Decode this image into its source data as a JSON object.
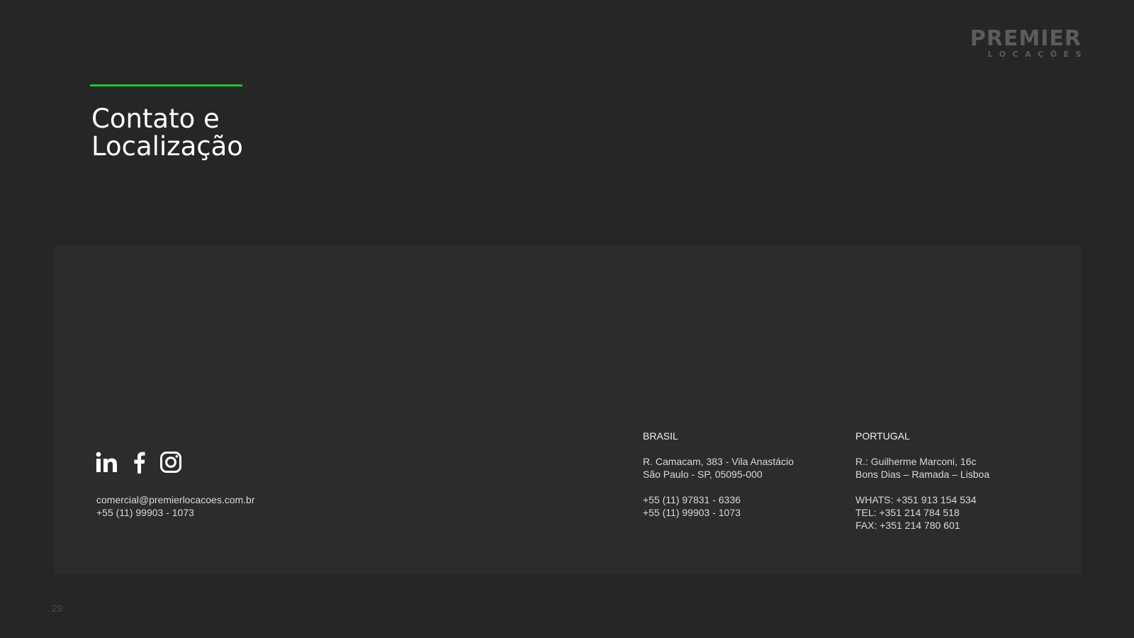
{
  "logo": {
    "brand": "PREMIER",
    "sub": "LOCAÇÕES"
  },
  "header": {
    "title_line1": "Contato e",
    "title_line2": "Localização"
  },
  "social": {
    "icons": [
      "linkedin-icon",
      "facebook-icon",
      "instagram-icon"
    ]
  },
  "contact": {
    "email": "comercial@premierlocacoes.com.br",
    "phone": "+55 (11) 99903 - 1073"
  },
  "brasil": {
    "heading": "BRASIL",
    "address_line1": "R. Camacam, 383 - Vila Anastácio",
    "address_line2": "São Paulo - SP, 05095-000",
    "phone1": "+55 (11) 97831 - 6336",
    "phone2": "+55 (11) 99903 - 1073"
  },
  "portugal": {
    "heading": "PORTUGAL",
    "address_line1": "R.: Guilherme Marconi, 16c",
    "address_line2": "Bons Dias – Ramada – Lisboa",
    "whats": "WHATS: +351 913 154 534",
    "tel": "TEL: +351 214 784 518",
    "fax": "FAX: +351 214 780 601"
  },
  "footer": {
    "page_number": "29"
  },
  "colors": {
    "background": "#262626",
    "panel": "#2c2c2c",
    "accent": "#22c32a"
  }
}
